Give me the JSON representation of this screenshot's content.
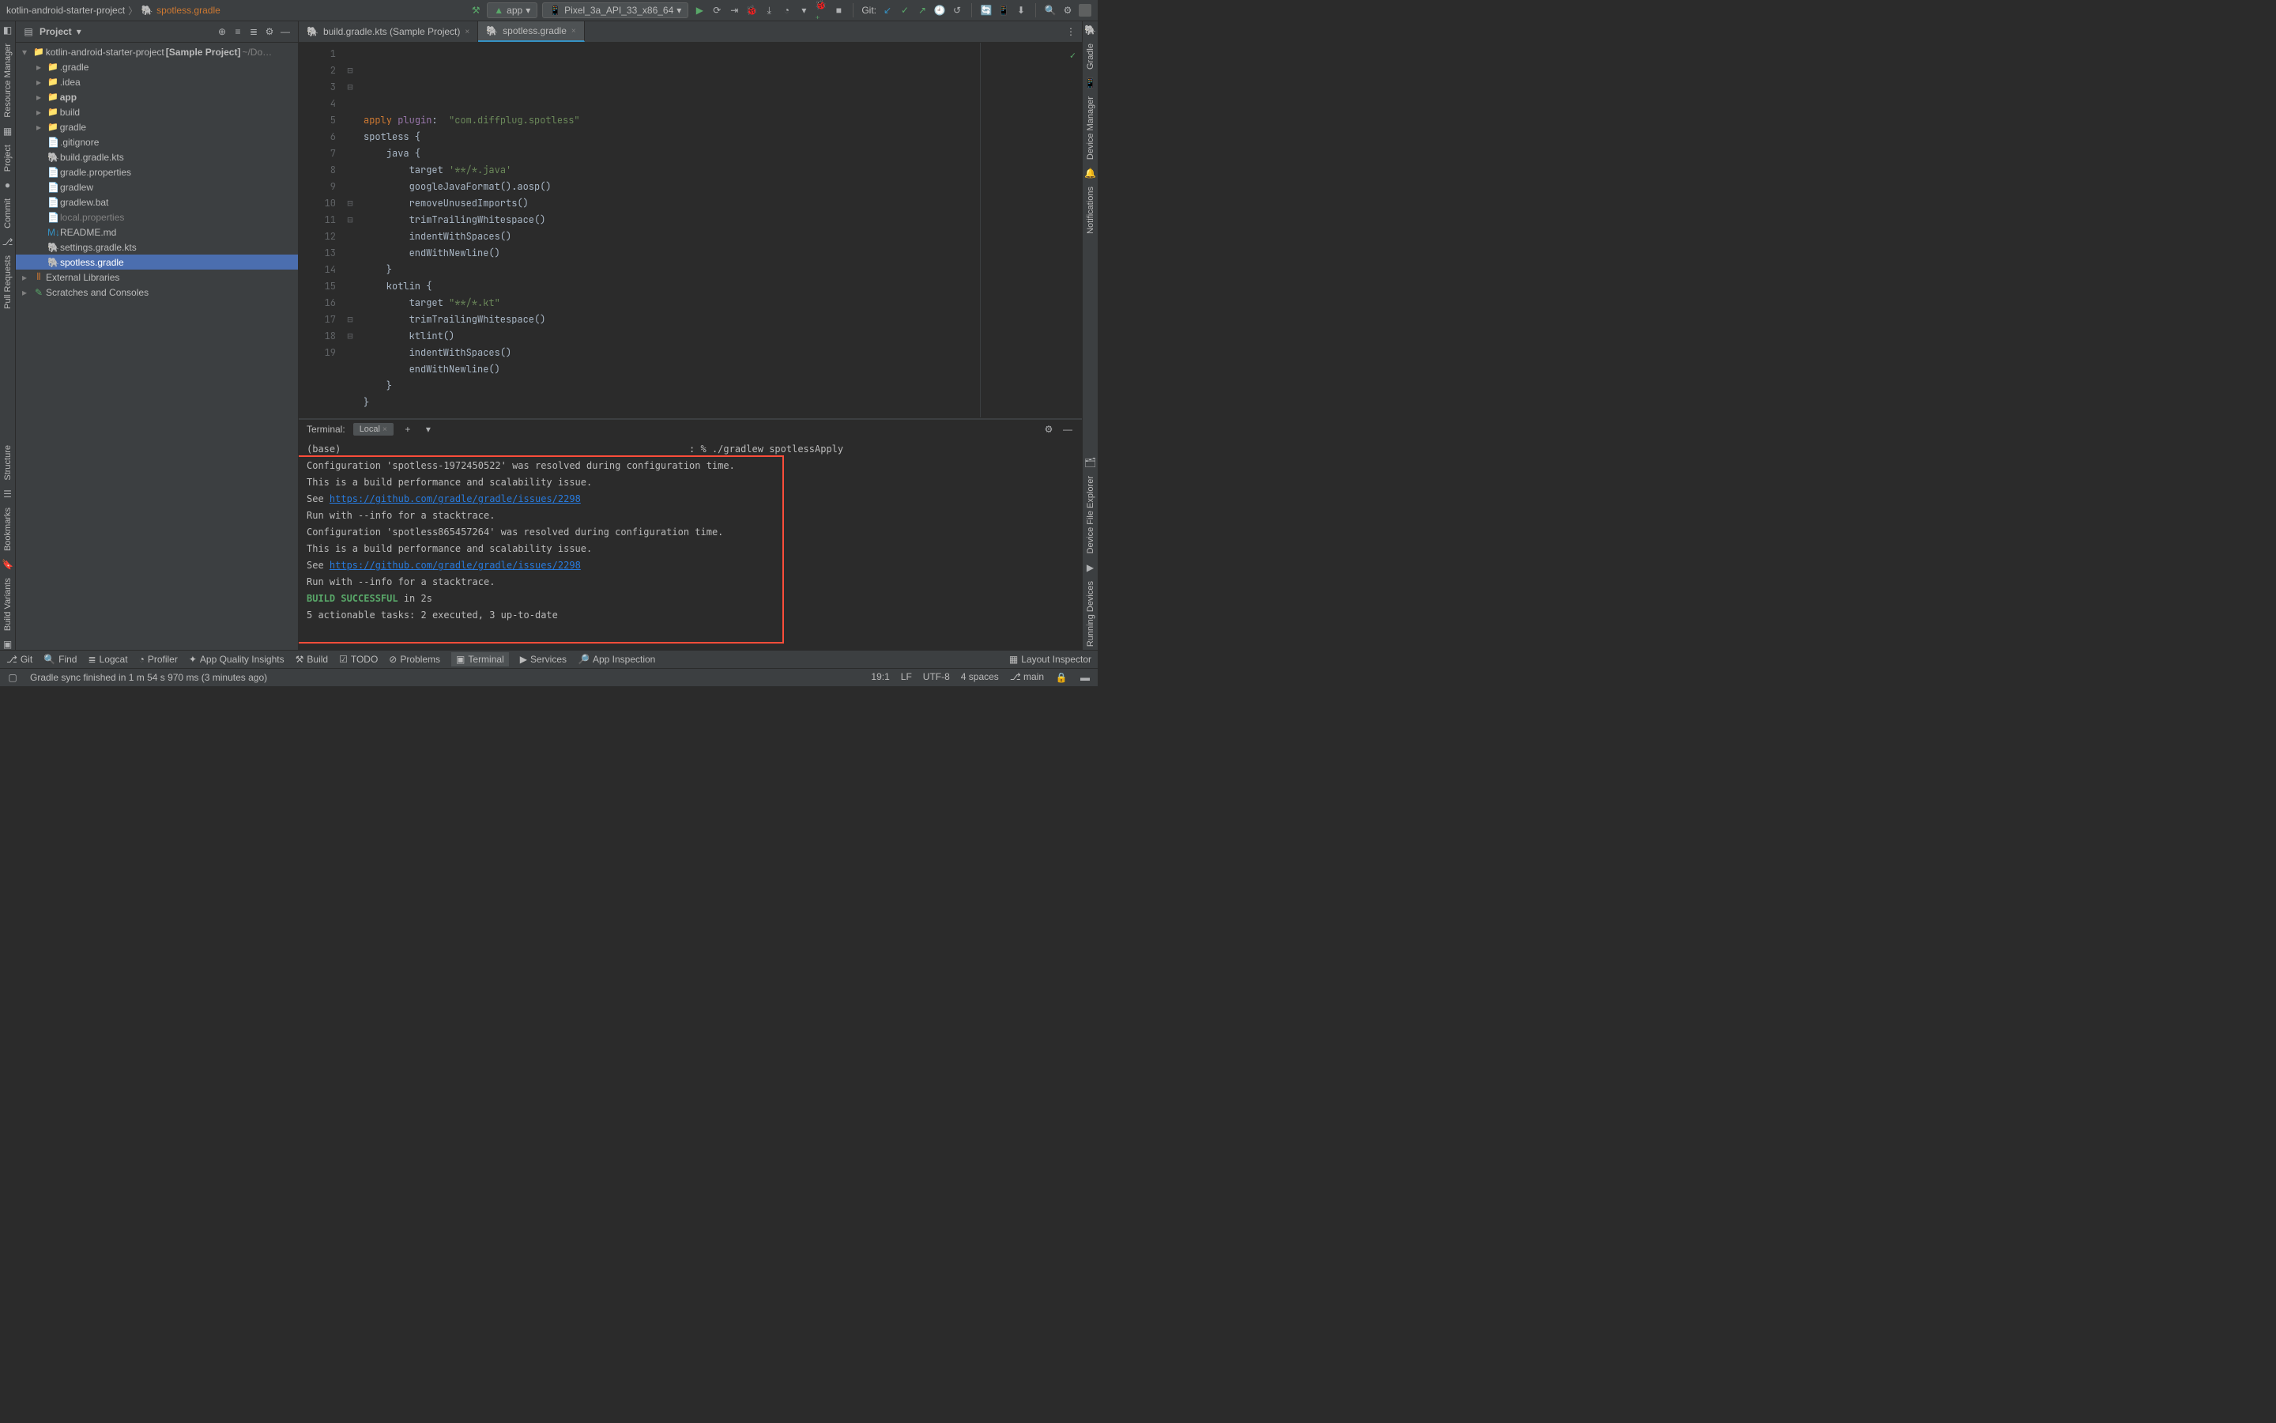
{
  "breadcrumb": {
    "root": "kotlin-android-starter-project",
    "file": "spotless.gradle"
  },
  "run_config": {
    "app": "app",
    "device": "Pixel_3a_API_33_x86_64"
  },
  "git_label": "Git:",
  "project_panel": {
    "title": "Project",
    "tree": [
      {
        "indent": 0,
        "arrow": "▾",
        "icon": "folder",
        "label": "kotlin-android-starter-project",
        "bold_suffix": " [Sample Project]",
        "suffix": "  ~/Do…"
      },
      {
        "indent": 1,
        "arrow": "▸",
        "icon": "orange",
        "label": ".gradle"
      },
      {
        "indent": 1,
        "arrow": "▸",
        "icon": "orange",
        "label": ".idea"
      },
      {
        "indent": 1,
        "arrow": "▸",
        "icon": "blue",
        "label": "app",
        "bold": true
      },
      {
        "indent": 1,
        "arrow": "▸",
        "icon": "orange",
        "label": "build"
      },
      {
        "indent": 1,
        "arrow": "▸",
        "icon": "folder",
        "label": "gradle"
      },
      {
        "indent": 1,
        "arrow": "",
        "icon": "file",
        "label": ".gitignore"
      },
      {
        "indent": 1,
        "arrow": "",
        "icon": "kts",
        "label": "build.gradle.kts"
      },
      {
        "indent": 1,
        "arrow": "",
        "icon": "file",
        "label": "gradle.properties"
      },
      {
        "indent": 1,
        "arrow": "",
        "icon": "file",
        "label": "gradlew"
      },
      {
        "indent": 1,
        "arrow": "",
        "icon": "file",
        "label": "gradlew.bat"
      },
      {
        "indent": 1,
        "arrow": "",
        "icon": "file",
        "label": "local.properties",
        "muted": true
      },
      {
        "indent": 1,
        "arrow": "",
        "icon": "md",
        "label": "README.md"
      },
      {
        "indent": 1,
        "arrow": "",
        "icon": "kts",
        "label": "settings.gradle.kts"
      },
      {
        "indent": 1,
        "arrow": "",
        "icon": "gradle",
        "label": "spotless.gradle",
        "selected": true
      },
      {
        "indent": 0,
        "arrow": "▸",
        "icon": "lib",
        "label": "External Libraries"
      },
      {
        "indent": 0,
        "arrow": "▸",
        "icon": "scratch",
        "label": "Scratches and Consoles"
      }
    ]
  },
  "tabs": [
    {
      "label": "build.gradle.kts (Sample Project)",
      "active": false
    },
    {
      "label": "spotless.gradle",
      "active": true
    }
  ],
  "editor": {
    "lines": [
      {
        "n": 1,
        "tokens": [
          [
            "kw",
            "apply"
          ],
          [
            "plain",
            " "
          ],
          [
            "id",
            "plugin"
          ],
          [
            "plain",
            ":  "
          ],
          [
            "str",
            "\"com.diffplug.spotless\""
          ]
        ]
      },
      {
        "n": 2,
        "tokens": [
          [
            "plain",
            "spotless {"
          ]
        ]
      },
      {
        "n": 3,
        "tokens": [
          [
            "plain",
            "    java {"
          ]
        ]
      },
      {
        "n": 4,
        "tokens": [
          [
            "plain",
            "        target "
          ],
          [
            "str",
            "'**/*.java'"
          ]
        ]
      },
      {
        "n": 5,
        "tokens": [
          [
            "plain",
            "        googleJavaFormat().aosp()"
          ]
        ]
      },
      {
        "n": 6,
        "tokens": [
          [
            "plain",
            "        removeUnusedImports()"
          ]
        ]
      },
      {
        "n": 7,
        "tokens": [
          [
            "plain",
            "        trimTrailingWhitespace()"
          ]
        ]
      },
      {
        "n": 8,
        "tokens": [
          [
            "plain",
            "        indentWithSpaces()"
          ]
        ]
      },
      {
        "n": 9,
        "tokens": [
          [
            "plain",
            "        endWithNewline()"
          ]
        ]
      },
      {
        "n": 10,
        "tokens": [
          [
            "plain",
            "    }"
          ]
        ]
      },
      {
        "n": 11,
        "tokens": [
          [
            "plain",
            "    kotlin {"
          ]
        ]
      },
      {
        "n": 12,
        "tokens": [
          [
            "plain",
            "        target "
          ],
          [
            "str",
            "\"**/*.kt\""
          ]
        ]
      },
      {
        "n": 13,
        "tokens": [
          [
            "plain",
            "        trimTrailingWhitespace()"
          ]
        ]
      },
      {
        "n": 14,
        "tokens": [
          [
            "plain",
            "        ktlint()"
          ]
        ]
      },
      {
        "n": 15,
        "tokens": [
          [
            "plain",
            "        indentWithSpaces()"
          ]
        ]
      },
      {
        "n": 16,
        "tokens": [
          [
            "plain",
            "        endWithNewline()"
          ]
        ]
      },
      {
        "n": 17,
        "tokens": [
          [
            "plain",
            "    }"
          ]
        ]
      },
      {
        "n": 18,
        "tokens": [
          [
            "plain",
            "}"
          ]
        ]
      },
      {
        "n": 19,
        "tokens": [
          [
            "plain",
            ""
          ]
        ],
        "cursor": true
      }
    ]
  },
  "terminal": {
    "title": "Terminal:",
    "tab": "Local",
    "prompt_prefix": "(base) ",
    "prompt_suffix": ": % ./gradlew spotlessApply",
    "lines": [
      {
        "t": "Configuration 'spotless-1972450522' was resolved during configuration time."
      },
      {
        "t": "This is a build performance and scalability issue."
      },
      {
        "prefix": "See ",
        "link": "https://github.com/gradle/gradle/issues/2298"
      },
      {
        "t": "Run with --info for a stacktrace."
      },
      {
        "t": "Configuration 'spotless865457264' was resolved during configuration time."
      },
      {
        "t": "This is a build performance and scalability issue."
      },
      {
        "prefix": "See ",
        "link": "https://github.com/gradle/gradle/issues/2298"
      },
      {
        "t": "Run with --info for a stacktrace."
      },
      {
        "t": ""
      },
      {
        "success": "BUILD SUCCESSFUL",
        "suffix": " in 2s"
      },
      {
        "t": "5 actionable tasks: 2 executed, 3 up-to-date"
      }
    ]
  },
  "bottom_tabs": [
    "Git",
    "Find",
    "Logcat",
    "Profiler",
    "App Quality Insights",
    "Build",
    "TODO",
    "Problems",
    "Terminal",
    "Services",
    "App Inspection"
  ],
  "bottom_right": "Layout Inspector",
  "status": {
    "left": "Gradle sync finished in 1 m 54 s 970 ms (3 minutes ago)",
    "pos": "19:1",
    "enc": "LF",
    "charset": "UTF-8",
    "indent": "4 spaces",
    "branch": "main"
  },
  "left_edge": [
    "Resource Manager",
    "Project",
    "Commit",
    "Pull Requests"
  ],
  "right_edge": [
    "Gradle",
    "Device Manager",
    "Notifications",
    "Device File Explorer",
    "Running Devices"
  ],
  "left_bottom": [
    "Structure",
    "Bookmarks",
    "Build Variants"
  ]
}
